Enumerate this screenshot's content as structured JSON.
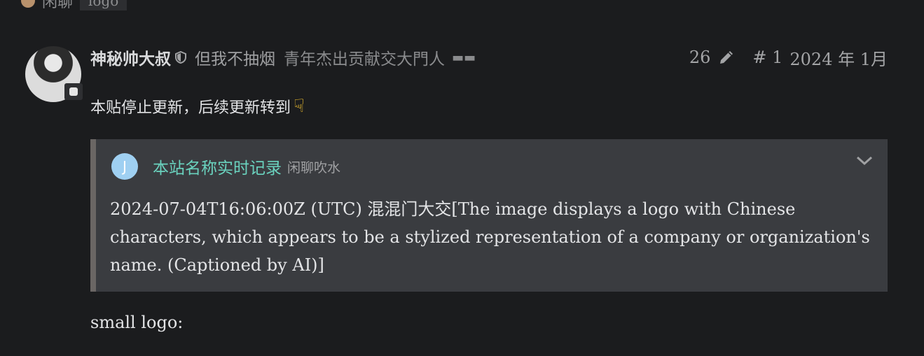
{
  "topbar": {
    "category": "闲聊",
    "tag": "logo"
  },
  "post": {
    "username": "神秘帅大叔",
    "user_title": "但我不抽烟",
    "user_flair": "青年杰出贡献交大門人",
    "edit_count": "26",
    "post_number": "# 1",
    "date": "2024 年 1月"
  },
  "content": {
    "line1": "本贴停止更新，后续更新转到",
    "small_logo": "small logo:"
  },
  "onebox": {
    "avatar_letter": "J",
    "title": "本站名称实时记录",
    "category": "闲聊吹水",
    "body": "2024-07-04T16:06:00Z (UTC) 混混门大交[The image displays a logo with Chinese characters, which appears to be a stylized representation of a company or organization's name. (Captioned by AI)]"
  },
  "colors": {
    "background": "#1b1c1e",
    "onebox_bg": "#3a3c40",
    "link_teal": "#6ad2be",
    "onebox_avatar": "#9fd0f2"
  },
  "icons": [
    "globe-icon",
    "shield-icon",
    "sunglasses-icon",
    "pencil-icon",
    "point-down-icon",
    "chevron-down-icon",
    "id-badge-icon"
  ]
}
